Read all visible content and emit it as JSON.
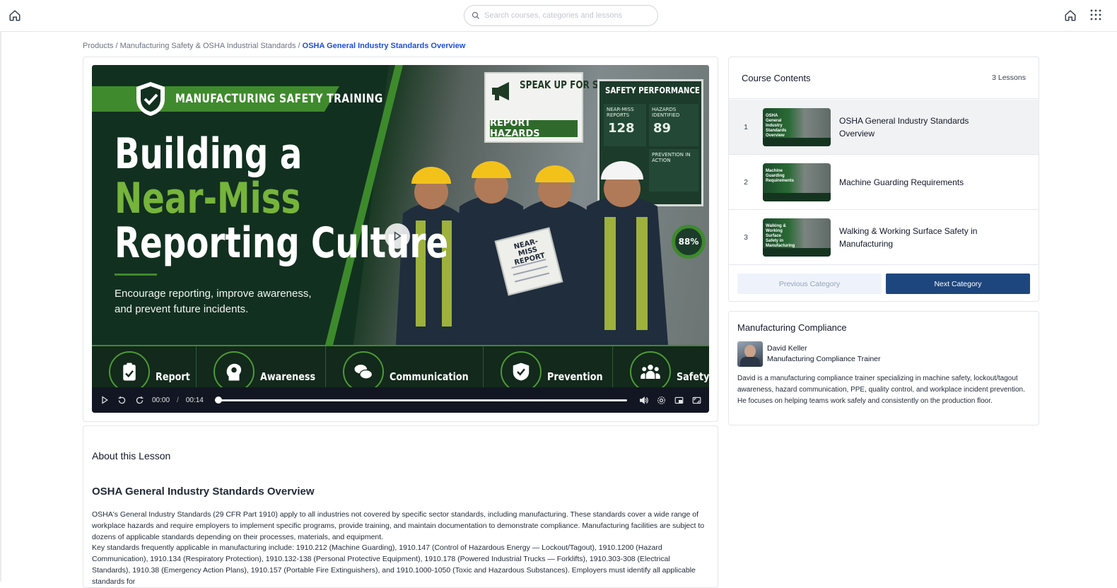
{
  "search": {
    "placeholder": "Search courses, categories and lessons"
  },
  "breadcrumb": {
    "items": [
      "Products",
      "Manufacturing Safety & OSHA Industrial Standards"
    ],
    "separator": "/",
    "current": "OSHA General Industry Standards Overview"
  },
  "video": {
    "banner": "MANUFACTURING SAFETY TRAINING",
    "title_line1": "Building a",
    "title_line2": "Near-Miss",
    "title_line3": "Reporting Culture",
    "subtitle": "Encourage reporting, improve awareness, and prevent future incidents.",
    "sign_speak_up": "SPEAK UP FOR SAFETY",
    "sign_report": "REPORT HAZARDS",
    "perf_title": "SAFETY PERFORMANCE",
    "perf_near_miss_label": "NEAR-MISS REPORTS",
    "perf_near_miss_value": "128",
    "perf_hazards_label": "HAZARDS IDENTIFIED",
    "perf_hazards_value": "89",
    "perf_prevention_label": "PREVENTION IN ACTION",
    "gauge_value": "88%",
    "clipboard_text": "NEAR-MISS REPORT",
    "features": [
      "Report",
      "Awareness",
      "Communication",
      "Prevention",
      "Safety Culture"
    ],
    "time_current": "00:00",
    "time_separator": "/",
    "time_total": "00:14",
    "progress": 0
  },
  "about": {
    "label": "About this Lesson",
    "lesson_title": "OSHA General Industry Standards Overview",
    "paragraph1": "OSHA's General Industry Standards (29 CFR Part 1910) apply to all industries not covered by specific sector standards, including manufacturing. These standards cover a wide range of workplace hazards and require employers to implement specific programs, provide training, and maintain documentation to demonstrate compliance. Manufacturing facilities are subject to dozens of applicable standards depending on their processes, materials, and equipment.",
    "paragraph2": "Key standards frequently applicable in manufacturing include: 1910.212 (Machine Guarding), 1910.147 (Control of Hazardous Energy — Lockout/Tagout), 1910.1200 (Hazard Communication), 1910.134 (Respiratory Protection), 1910.132-138 (Personal Protective Equipment), 1910.178 (Powered Industrial Trucks — Forklifts), 1910.303-308 (Electrical Standards), 1910.38 (Emergency Action Plans), 1910.157 (Portable Fire Extinguishers), and 1910.1000-1050 (Toxic and Hazardous Substances). Employers must identify all applicable standards for"
  },
  "contents": {
    "title": "Course Contents",
    "count": "3 Lessons",
    "lessons": [
      {
        "num": "1",
        "label": "OSHA General Industry Standards Overview",
        "thumb_text": "OSHA General Industry Standards Overview"
      },
      {
        "num": "2",
        "label": "Machine Guarding Requirements",
        "thumb_text": "Machine Guarding Requirements"
      },
      {
        "num": "3",
        "label": "Walking & Working Surface Safety in Manufacturing",
        "thumb_text": "Walking & Working Surface Safety in Manufacturing"
      }
    ],
    "prev_label": "Previous Category",
    "next_label": "Next Category"
  },
  "compliance": {
    "title": "Manufacturing Compliance",
    "instructor_name": "David Keller",
    "instructor_role": "Manufacturing Compliance Trainer",
    "bio": "David is a manufacturing compliance trainer specializing in machine safety, lockout/tagout awareness, hazard communication, PPE, quality control, and workplace incident prevention. He focuses on helping teams work safely and consistently on the production floor."
  },
  "colors": {
    "accent": "#1d4ed8",
    "next_button": "#1e467e",
    "video_green": "#3f8a2d"
  },
  "icons": [
    "home-icon",
    "grid-menu-icon",
    "search-icon",
    "play-icon",
    "rewind-icon",
    "forward-icon",
    "volume-icon",
    "settings-icon",
    "pip-icon",
    "fullscreen-icon"
  ]
}
